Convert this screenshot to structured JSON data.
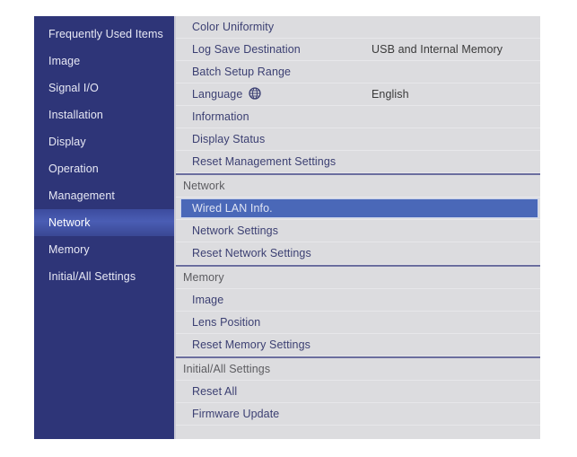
{
  "menu": {
    "sidebar": {
      "items": [
        {
          "label": "Frequently Used Items",
          "selected": false
        },
        {
          "label": "Image",
          "selected": false
        },
        {
          "label": "Signal I/O",
          "selected": false
        },
        {
          "label": "Installation",
          "selected": false
        },
        {
          "label": "Display",
          "selected": false
        },
        {
          "label": "Operation",
          "selected": false
        },
        {
          "label": "Management",
          "selected": false
        },
        {
          "label": "Network",
          "selected": true
        },
        {
          "label": "Memory",
          "selected": false
        },
        {
          "label": "Initial/All Settings",
          "selected": false
        }
      ]
    },
    "list": {
      "rows": [
        {
          "type": "item",
          "label": "Color Uniformity",
          "value": "",
          "selected": false,
          "icon": ""
        },
        {
          "type": "item",
          "label": "Log Save Destination",
          "value": "USB and Internal Memory",
          "selected": false,
          "icon": ""
        },
        {
          "type": "item",
          "label": "Batch Setup Range",
          "value": "",
          "selected": false,
          "icon": ""
        },
        {
          "type": "item",
          "label": "Language",
          "value": "English",
          "selected": false,
          "icon": "globe-icon"
        },
        {
          "type": "item",
          "label": "Information",
          "value": "",
          "selected": false,
          "icon": ""
        },
        {
          "type": "item",
          "label": "Display Status",
          "value": "",
          "selected": false,
          "icon": ""
        },
        {
          "type": "item",
          "label": "Reset Management Settings",
          "value": "",
          "selected": false,
          "icon": ""
        },
        {
          "type": "section",
          "label": "Network",
          "value": "",
          "selected": false,
          "icon": ""
        },
        {
          "type": "item",
          "label": "Wired LAN Info.",
          "value": "",
          "selected": true,
          "icon": ""
        },
        {
          "type": "item",
          "label": "Network Settings",
          "value": "",
          "selected": false,
          "icon": ""
        },
        {
          "type": "item",
          "label": "Reset Network Settings",
          "value": "",
          "selected": false,
          "icon": ""
        },
        {
          "type": "section",
          "label": "Memory",
          "value": "",
          "selected": false,
          "icon": ""
        },
        {
          "type": "item",
          "label": "Image",
          "value": "",
          "selected": false,
          "icon": ""
        },
        {
          "type": "item",
          "label": "Lens Position",
          "value": "",
          "selected": false,
          "icon": ""
        },
        {
          "type": "item",
          "label": "Reset Memory Settings",
          "value": "",
          "selected": false,
          "icon": ""
        },
        {
          "type": "section",
          "label": "Initial/All Settings",
          "value": "",
          "selected": false,
          "icon": ""
        },
        {
          "type": "item",
          "label": "Reset All",
          "value": "",
          "selected": false,
          "icon": ""
        },
        {
          "type": "item",
          "label": "Firmware Update",
          "value": "",
          "selected": false,
          "icon": ""
        }
      ]
    }
  },
  "colors": {
    "sidebar_background": "#2e3578",
    "sidebar_selected": "#4a5db4",
    "list_background": "#dcdcdf",
    "row_selected": "#4a68b8",
    "item_label": "#3b3f72",
    "section_label": "#5c5c60",
    "value_text": "#3a3a3a",
    "section_divider": "#6b6e9e"
  }
}
